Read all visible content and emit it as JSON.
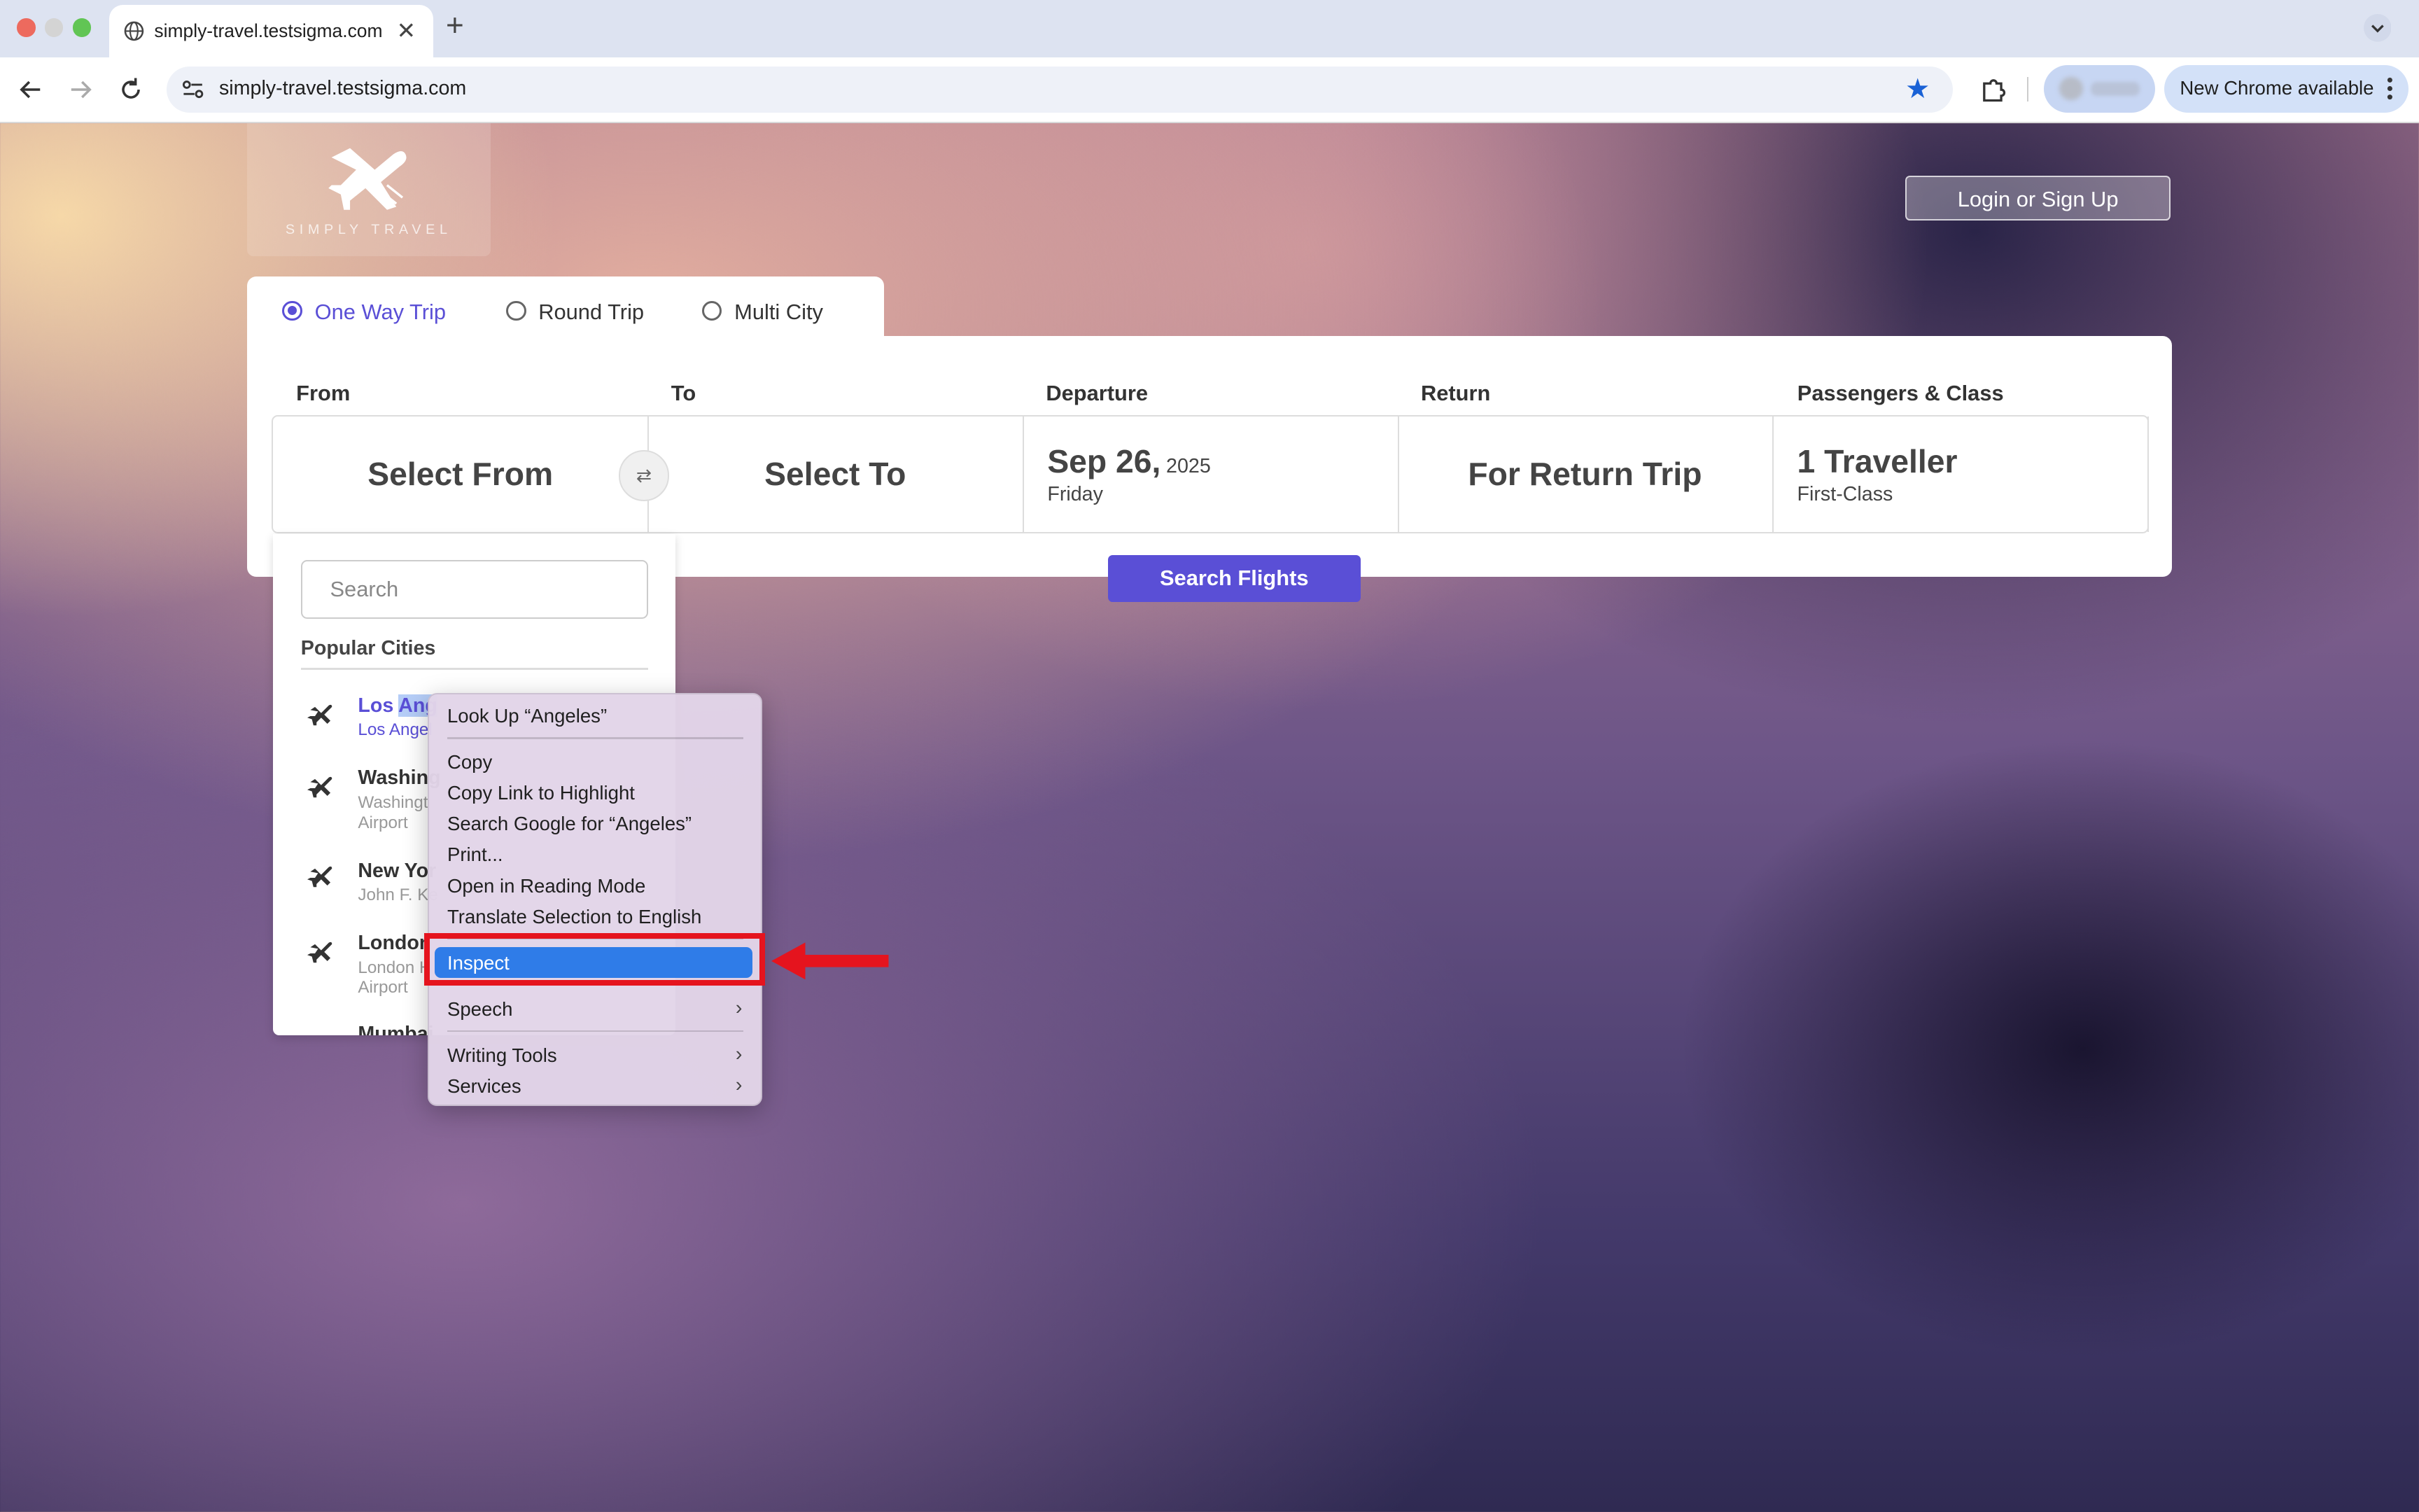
{
  "browser": {
    "tab_title": "simply-travel.testsigma.com",
    "url": "simply-travel.testsigma.com",
    "update_label": "New Chrome available",
    "icons": [
      "globe-icon",
      "close-icon",
      "plus-icon",
      "chevron-down-icon",
      "back-icon",
      "forward-icon",
      "reload-icon",
      "site-info-icon",
      "star-icon",
      "extensions-icon",
      "kebab-icon"
    ]
  },
  "site": {
    "logo_text": "SIMPLY TRAVEL",
    "login_label": "Login or Sign Up"
  },
  "trip_types": [
    {
      "label": "One Way Trip",
      "checked": true
    },
    {
      "label": "Round Trip",
      "checked": false
    },
    {
      "label": "Multi City",
      "checked": false
    }
  ],
  "columns": {
    "from": "From",
    "to": "To",
    "departure": "Departure",
    "return": "Return",
    "passengers": "Passengers & Class"
  },
  "fields": {
    "from": "Select From",
    "to": "Select To",
    "departure_date": "Sep 26,",
    "departure_year": "2025",
    "departure_day": "Friday",
    "return": "For Return Trip",
    "passengers": "1 Traveller",
    "class": "First-Class"
  },
  "search_button": "Search Flights",
  "dropdown": {
    "search_placeholder": "Search",
    "title": "Popular Cities",
    "cities": [
      {
        "name_a": "Los ",
        "name_sel": "Ang",
        "sub": "Los Angel"
      },
      {
        "name": "Washing",
        "sub": "Washingt Airport"
      },
      {
        "name": "New Yor",
        "sub": "John F. Ke"
      },
      {
        "name": "London",
        "sub": "London H Airport"
      },
      {
        "name": "Mumbai"
      }
    ]
  },
  "context_menu": {
    "lookup": "Look Up “Angeles”",
    "copy": "Copy",
    "copy_link": "Copy Link to Highlight",
    "search_google": "Search Google for “Angeles”",
    "print": "Print...",
    "reading_mode": "Open in Reading Mode",
    "translate": "Translate Selection to English",
    "inspect": "Inspect",
    "speech": "Speech",
    "writing_tools": "Writing Tools",
    "services": "Services"
  },
  "colors": {
    "accent": "#5a4fd6",
    "menu_highlight": "#2f7ce8",
    "annotation": "#e5141e"
  }
}
